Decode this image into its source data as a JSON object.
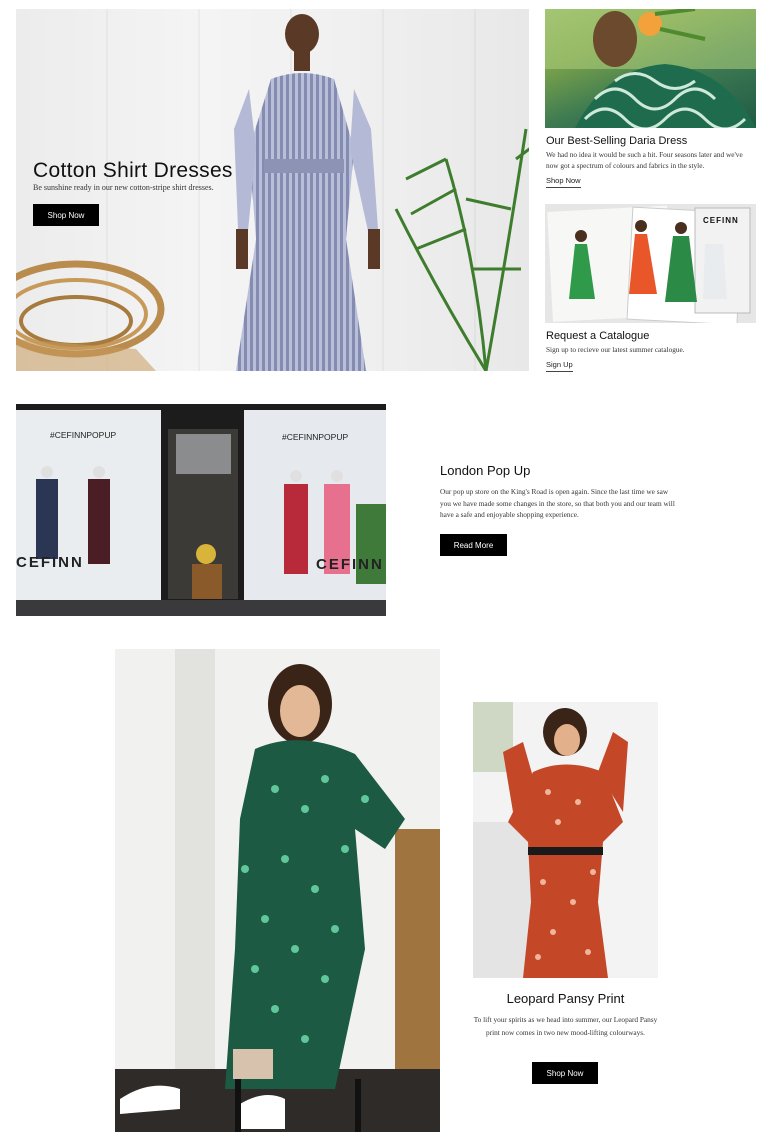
{
  "hero": {
    "title": "Cotton Shirt Dresses",
    "subtitle": "Be sunshine ready in our new cotton-stripe shirt dresses.",
    "button_label": "Shop Now"
  },
  "daria": {
    "title": "Our Best-Selling Daria Dress",
    "text": "We had no idea it would be such a hit. Four seasons later and we've now got a spectrum of colours and fabrics in the style.",
    "link_label": "Shop Now"
  },
  "catalogue": {
    "title": "Request a Catalogue",
    "text": "Sign up to recieve our latest summer catalogue.",
    "link_label": "Sign Up",
    "cover_brand": "CEFINN"
  },
  "london": {
    "title": "London Pop Up",
    "text": "Our pop up store on the King's Road is open again. Since the last time we saw you we have made some changes in the store, so that both you and our team will have a safe and enjoyable shopping experience.",
    "button_label": "Read More",
    "window_sign_left": "#CEFINNPOPUP",
    "window_sign_right": "#CEFINNPOPUP",
    "window_brand_left": "CEFINN",
    "window_brand_right": "CEFINN"
  },
  "leopard": {
    "title": "Leopard Pansy Print",
    "text": "To lift your spirits as we head into summer, our Leopard Pansy print now comes in two new mood-lifting colourways.",
    "button_label": "Shop Now"
  },
  "colors": {
    "button_bg": "#000000",
    "button_text": "#ffffff",
    "dress_green": "#1f6b4e",
    "dress_red": "#c8452a"
  }
}
